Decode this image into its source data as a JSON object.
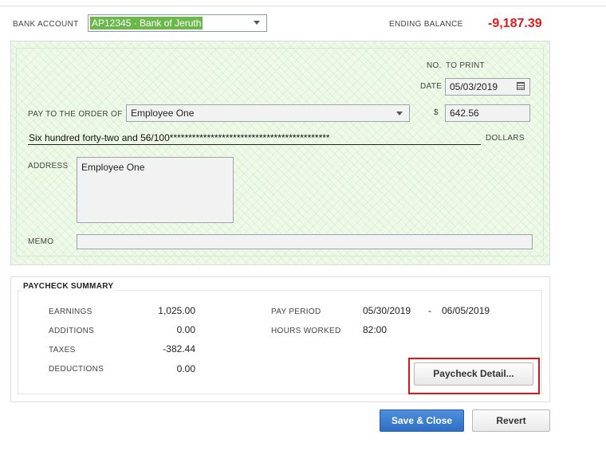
{
  "header": {
    "bank_account_label": "BANK ACCOUNT",
    "bank_account_value": "AP12345 · Bank of Jeruth",
    "ending_balance_label": "ENDING BALANCE",
    "ending_balance_value": "-9,187.39",
    "ending_balance_color": "#e0191b"
  },
  "check": {
    "no_label": "NO.",
    "no_value": "TO PRINT",
    "date_label": "DATE",
    "date_value": "05/03/2019",
    "pay_to_label": "PAY TO THE ORDER OF",
    "pay_to_value": "Employee One",
    "dollar_sign": "$",
    "amount_value": "642.56",
    "amount_words": "Six hundred forty-two and 56/100*******************************************",
    "dollars_label": "DOLLARS",
    "address_label": "ADDRESS",
    "address_value": "Employee One",
    "memo_label": "MEMO",
    "memo_value": ""
  },
  "summary": {
    "title": "PAYCHECK SUMMARY",
    "rows": [
      {
        "label": "EARNINGS",
        "value": "1,025.00"
      },
      {
        "label": "ADDITIONS",
        "value": "0.00"
      },
      {
        "label": "TAXES",
        "value": "-382.44"
      },
      {
        "label": "DEDUCTIONS",
        "value": "0.00"
      }
    ],
    "pay_period_label": "PAY PERIOD",
    "pay_period_start": "05/30/2019",
    "pay_period_sep": "-",
    "pay_period_end": "06/05/2019",
    "hours_worked_label": "HOURS WORKED",
    "hours_worked_value": "82:00",
    "detail_button": "Paycheck Detail..."
  },
  "footer": {
    "save_close": "Save & Close",
    "revert": "Revert"
  },
  "colors": {
    "highlight": "#e01616",
    "check_background": "#eef9e8",
    "primary_button": "#3b7fd3",
    "selection": "#6bb84a"
  }
}
